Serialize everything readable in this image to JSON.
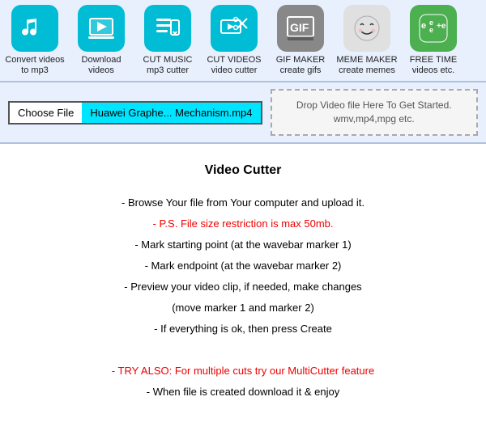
{
  "nav": {
    "items": [
      {
        "id": "mp3",
        "iconClass": "icon-mp3",
        "label": "Convert videos to mp3",
        "iconType": "music-note"
      },
      {
        "id": "download",
        "iconClass": "icon-download",
        "label": "Download videos",
        "iconType": "download-video"
      },
      {
        "id": "cut-music",
        "iconClass": "icon-cut-music",
        "label": "CUT MUSIC mp3 cutter",
        "iconType": "cut-music"
      },
      {
        "id": "cut-video",
        "iconClass": "icon-cut-video",
        "label": "CUT VIDEOS video cutter",
        "iconType": "cut-video"
      },
      {
        "id": "gif",
        "iconClass": "icon-gif",
        "label": "GIF MAKER create gifs",
        "iconType": "gif"
      },
      {
        "id": "meme",
        "iconClass": "icon-meme",
        "label": "MEME MAKER create memes",
        "iconType": "meme"
      },
      {
        "id": "free",
        "iconClass": "icon-free",
        "label": "FREE TIME videos etc.",
        "iconType": "free"
      }
    ]
  },
  "upload": {
    "choose_file_label": "Choose File",
    "file_name": "Huawei Graphe... Mechanism.mp4",
    "drop_zone_line1": "Drop Video file Here To Get Started.",
    "drop_zone_line2": "wmv,mp4,mpg etc."
  },
  "main": {
    "title": "Video Cutter",
    "instructions": [
      {
        "text": "- Browse Your file from Your computer and upload it.",
        "style": "normal"
      },
      {
        "text": "- P.S. File size restriction is max 50mb.",
        "style": "red"
      },
      {
        "text": "- Mark starting point (at the wavebar marker 1)",
        "style": "normal"
      },
      {
        "text": "- Mark endpoint (at the wavebar marker 2)",
        "style": "normal"
      },
      {
        "text": "- Preview your video clip, if needed, make changes",
        "style": "normal"
      },
      {
        "text": "(move marker 1 and marker 2)",
        "style": "normal"
      },
      {
        "text": "- If everything is ok, then press Create",
        "style": "normal"
      },
      {
        "text": "",
        "style": "normal"
      },
      {
        "text": "- TRY ALSO: For multiple cuts try our MultiCutter feature",
        "style": "red"
      },
      {
        "text": "- When file is created download it & enjoy",
        "style": "normal"
      }
    ]
  }
}
